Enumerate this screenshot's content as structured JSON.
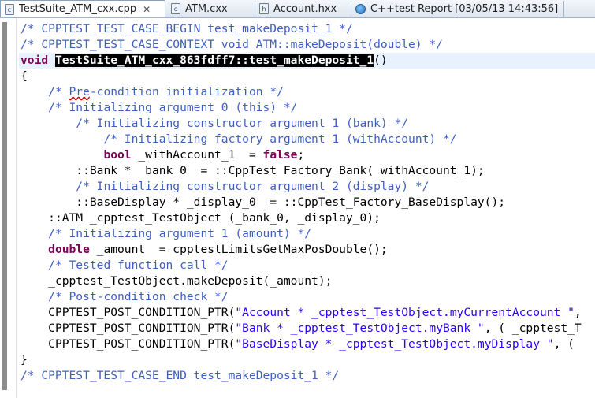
{
  "tabs": [
    {
      "label": "TestSuite_ATM_cxx.cpp",
      "icon": "c-file-icon",
      "active": true,
      "close": "✕"
    },
    {
      "label": "ATM.cxx",
      "icon": "c-file-icon",
      "active": false
    },
    {
      "label": "Account.hxx",
      "icon": "h-file-icon",
      "active": false
    },
    {
      "label": "C++test Report [03/05/13 14:43:56]",
      "icon": "globe-icon",
      "active": false
    }
  ],
  "code": {
    "l1": "/* CPPTEST_TEST_CASE_BEGIN test_makeDeposit_1 */",
    "l2": "/* CPPTEST_TEST_CASE_CONTEXT void ATM::makeDeposit(double) */",
    "l3_kw": "void",
    "l3_sel": "TestSuite_ATM_cxx_863fdff7::test_makeDeposit_1",
    "l3_rest": "()",
    "l4": "{",
    "l5_a": "/* ",
    "l5_typo": "Pre",
    "l5_b": "-condition initialization */",
    "l6": "/* Initializing argument 0 (this) */",
    "l7": "/* Initializing constructor argument 1 (bank) */",
    "l8": "/* Initializing factory argument 1 (withAccount) */",
    "l9_kw": "bool",
    "l9_a": " _withAccount_1  = ",
    "l9_kw2": "false",
    "l9_b": ";",
    "l10": "::Bank * _bank_0  = ::CppTest_Factory_Bank(_withAccount_1);",
    "l11": "/* Initializing constructor argument 2 (display) */",
    "l12": "::BaseDisplay * _display_0  = ::CppTest_Factory_BaseDisplay();",
    "l13": "::ATM _cpptest_TestObject (_bank_0, _display_0);",
    "l14": "/* Initializing argument 1 (amount) */",
    "l15_kw": "double",
    "l15_a": " _amount  = cpptestLimitsGetMaxPosDouble();",
    "l16": "/* Tested function call */",
    "l17": "_cpptest_TestObject.makeDeposit(_amount);",
    "l18": "/* Post-condition check */",
    "l19_a": "CPPTEST_POST_CONDITION_PTR(",
    "l19_str": "\"Account * _cpptest_TestObject.myCurrentAccount \"",
    "l19_b": ",",
    "l20_a": "CPPTEST_POST_CONDITION_PTR(",
    "l20_str": "\"Bank * _cpptest_TestObject.myBank \"",
    "l20_b": ", ( _cpptest_T",
    "l21_a": "CPPTEST_POST_CONDITION_PTR(",
    "l21_str": "\"BaseDisplay * _cpptest_TestObject.myDisplay \"",
    "l21_b": ", (",
    "l22": "}",
    "l23": "/* CPPTEST_TEST_CASE_END test_makeDeposit_1 */"
  }
}
